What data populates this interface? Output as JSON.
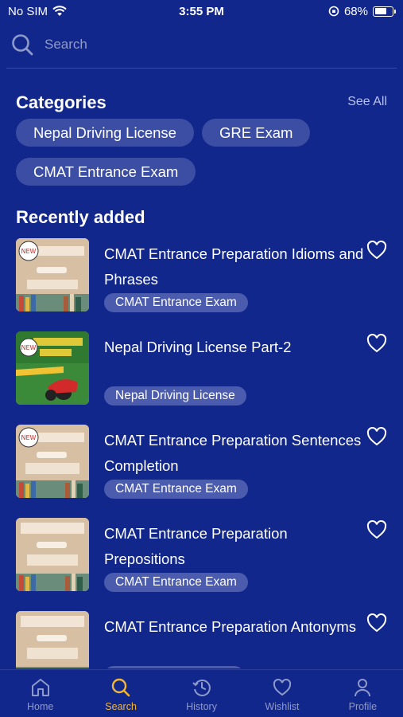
{
  "status": {
    "carrier": "No SIM",
    "time": "3:55 PM",
    "battery_text": "68%",
    "battery_level": 0.68
  },
  "search": {
    "placeholder": "Search"
  },
  "categories": {
    "title": "Categories",
    "see_all": "See All",
    "chips": [
      "Nepal Driving License",
      "GRE Exam",
      "CMAT Entrance Exam"
    ]
  },
  "recent": {
    "title": "Recently added",
    "items": [
      {
        "title": "CMAT Entrance Preparation Idioms and Phrases",
        "tag": "CMAT Entrance Exam",
        "thumb": "idioms-cover",
        "new": true
      },
      {
        "title": "Nepal Driving License Part-2",
        "tag": "Nepal Driving License",
        "thumb": "driving-cover",
        "new": true
      },
      {
        "title": "CMAT Entrance Preparation Sentences Completion",
        "tag": "CMAT Entrance Exam",
        "thumb": "sentences-cover",
        "new": true
      },
      {
        "title": "CMAT Entrance Preparation Prepositions",
        "tag": "CMAT Entrance Exam",
        "thumb": "prepositions-cover",
        "new": false
      },
      {
        "title": "CMAT Entrance Preparation Antonyms",
        "tag": "",
        "thumb": "antonyms-cover",
        "new": false
      }
    ]
  },
  "tabs": [
    {
      "label": "Home",
      "icon": "home-icon",
      "active": false
    },
    {
      "label": "Search",
      "icon": "search-icon",
      "active": true
    },
    {
      "label": "History",
      "icon": "history-icon",
      "active": false
    },
    {
      "label": "Wishlist",
      "icon": "heart-icon",
      "active": false
    },
    {
      "label": "Profile",
      "icon": "profile-icon",
      "active": false
    }
  ],
  "colors": {
    "background": "#12278c",
    "chip": "#3c4ea4",
    "tag": "#4b5cae",
    "active_tab": "#f2b535",
    "inactive_tab": "#8f9acb"
  }
}
